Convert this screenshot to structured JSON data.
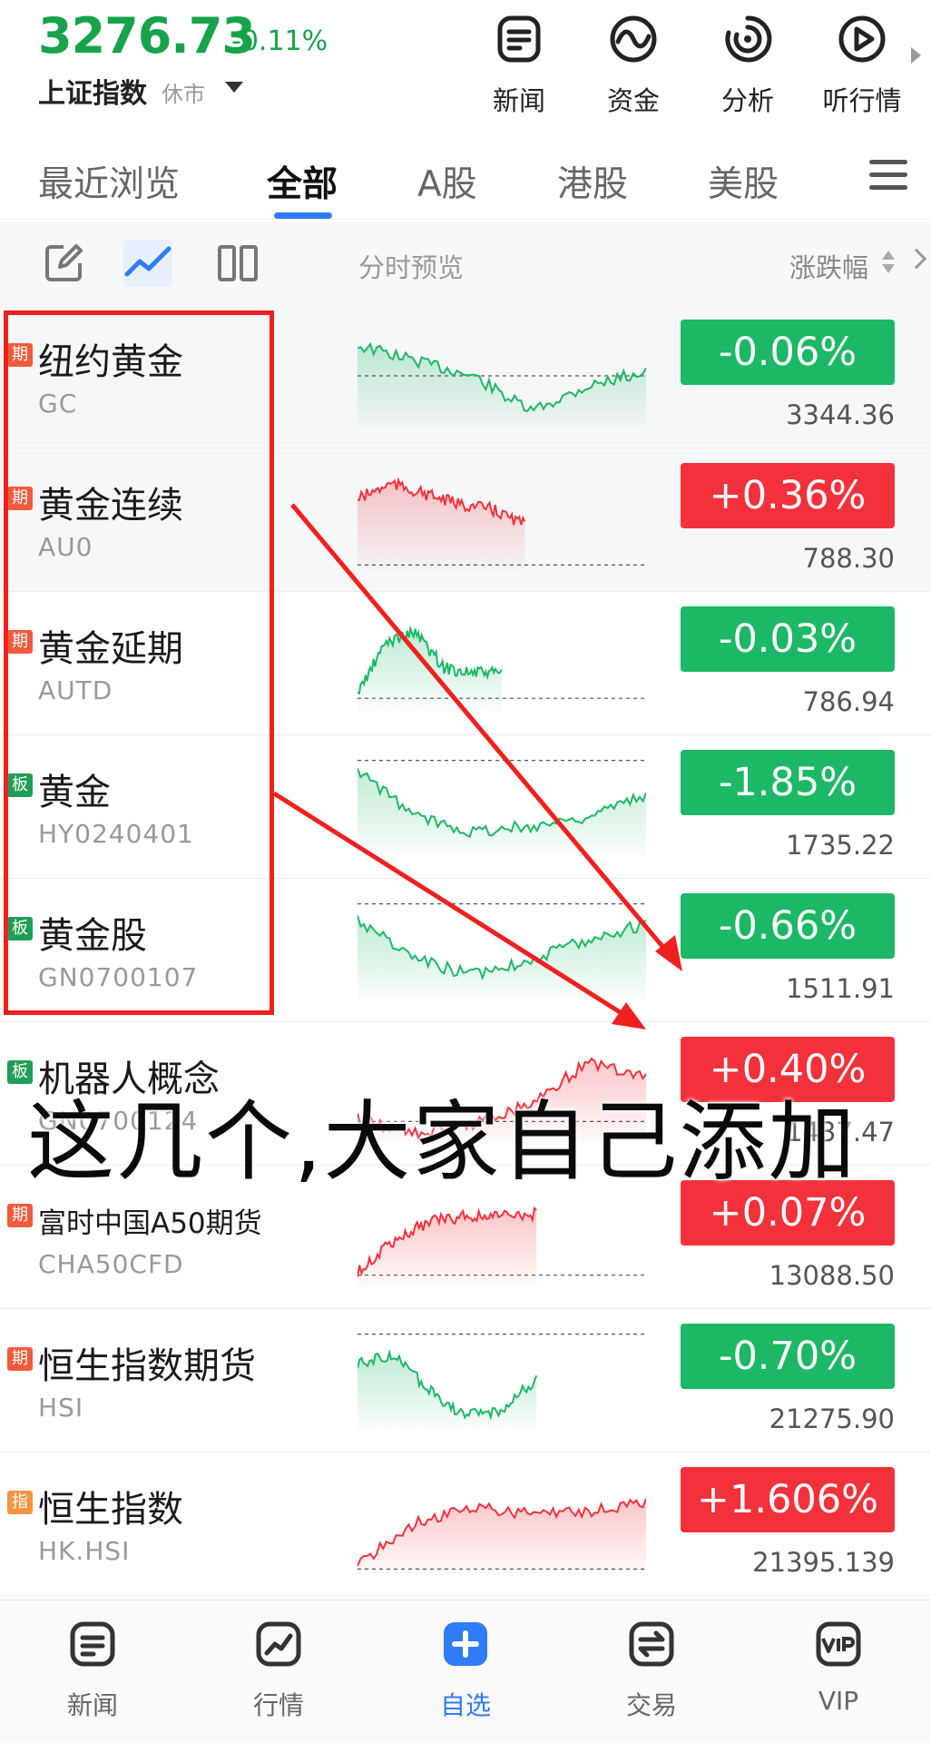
{
  "header": {
    "index_value": "3276.73",
    "index_change": "-0.11%",
    "index_name": "上证指数",
    "index_status": "休市",
    "buttons": [
      {
        "label": "新闻",
        "icon": "news-icon"
      },
      {
        "label": "资金",
        "icon": "fund-flow-icon"
      },
      {
        "label": "分析",
        "icon": "analysis-icon"
      },
      {
        "label": "听行情",
        "icon": "play-icon"
      }
    ]
  },
  "tabs": [
    "最近浏览",
    "全部",
    "A股",
    "港股",
    "美股"
  ],
  "active_tab": "全部",
  "toolbar": {
    "preview_label": "分时预览",
    "sort_label": "涨跌幅",
    "icons": [
      "edit-icon",
      "trend-line-icon",
      "columns-icon"
    ]
  },
  "colors": {
    "up": "#f2313b",
    "down": "#1cb865",
    "tag_futures": "#f25a3c",
    "tag_board": "#1f9e55",
    "tag_index": "#f59342",
    "accent": "#2f7cf6",
    "annotation": "#f0201f"
  },
  "rows": [
    {
      "tag": "期",
      "tag_type": "futures",
      "name": "纽约黄金",
      "code": "GC",
      "change": "-0.06%",
      "price": "3344.36",
      "dir": "down"
    },
    {
      "tag": "期",
      "tag_type": "futures",
      "name": "黄金连续",
      "code": "AU0",
      "change": "+0.36%",
      "price": "788.30",
      "dir": "up"
    },
    {
      "tag": "期",
      "tag_type": "futures",
      "name": "黄金延期",
      "code": "AUTD",
      "change": "-0.03%",
      "price": "786.94",
      "dir": "down"
    },
    {
      "tag": "板",
      "tag_type": "board",
      "name": "黄金",
      "code": "HY0240401",
      "change": "-1.85%",
      "price": "1735.22",
      "dir": "down"
    },
    {
      "tag": "板",
      "tag_type": "board",
      "name": "黄金股",
      "code": "GN0700107",
      "change": "-0.66%",
      "price": "1511.91",
      "dir": "down"
    },
    {
      "tag": "板",
      "tag_type": "board",
      "name": "机器人概念",
      "code": "GN0700124",
      "change": "+0.40%",
      "price": "1437.47",
      "dir": "up"
    },
    {
      "tag": "期",
      "tag_type": "futures",
      "name": "富时中国A50期货",
      "code": "CHA50CFD",
      "change": "+0.07%",
      "price": "13088.50",
      "dir": "up"
    },
    {
      "tag": "期",
      "tag_type": "futures",
      "name": "恒生指数期货",
      "code": "HSI",
      "change": "-0.70%",
      "price": "21275.90",
      "dir": "down"
    },
    {
      "tag": "指",
      "tag_type": "index",
      "name": "恒生指数",
      "code": "HK.HSI",
      "change": "+1.606%",
      "price": "21395.139",
      "dir": "up"
    }
  ],
  "annotation": {
    "caption": "这几个,大家自己添加"
  },
  "bottom_nav": [
    {
      "label": "新闻",
      "icon": "news-icon"
    },
    {
      "label": "行情",
      "icon": "market-icon"
    },
    {
      "label": "自选",
      "icon": "add-icon"
    },
    {
      "label": "交易",
      "icon": "exchange-icon"
    },
    {
      "label": "VIP",
      "icon": "vip-icon"
    }
  ],
  "bottom_nav_active": "自选"
}
